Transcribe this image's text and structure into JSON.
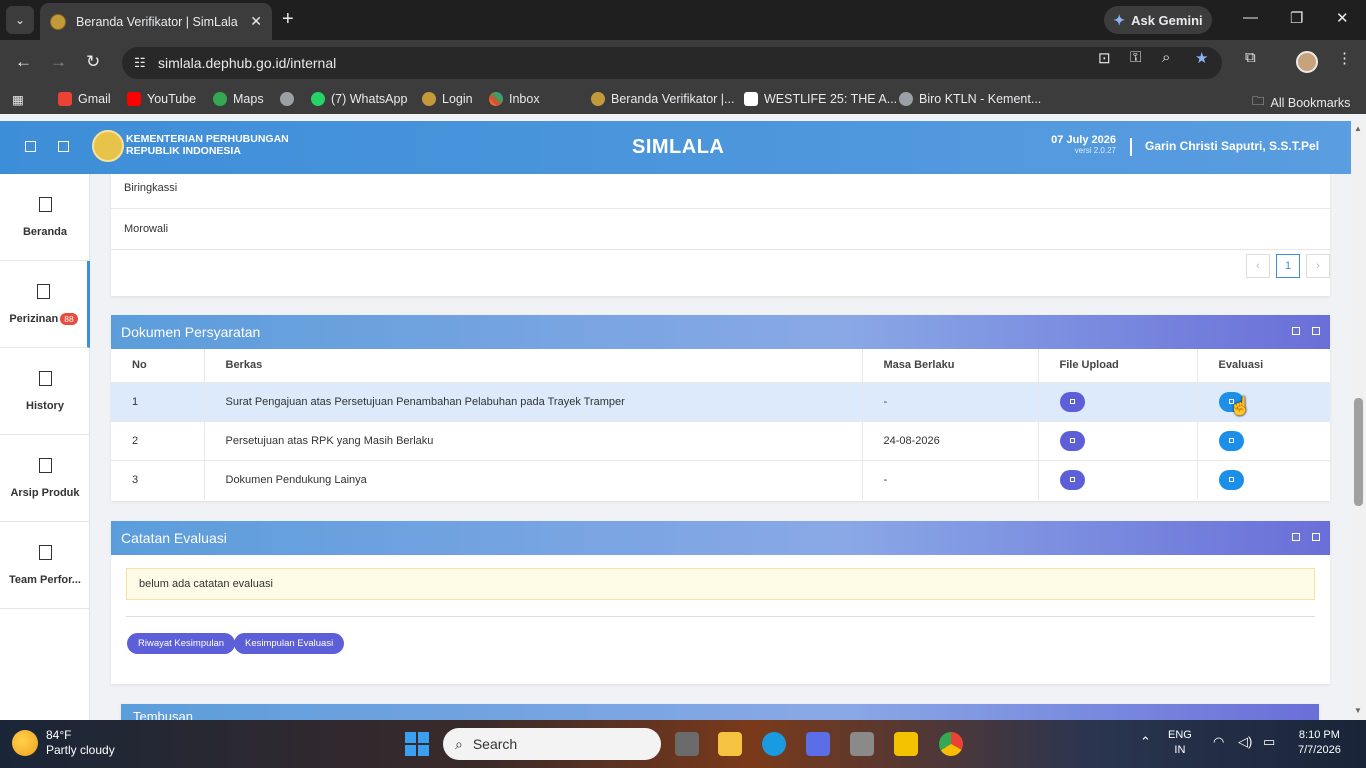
{
  "browser": {
    "tab_title": "Beranda Verifikator | SimLala",
    "url": "simlala.dephub.go.id/internal",
    "ask_gemini": "Ask Gemini",
    "bookmarks": [
      "Gmail",
      "YouTube",
      "Maps",
      "(7) WhatsApp",
      "Login",
      "Inbox",
      "Beranda Verifikator |...",
      "WESTLIFE 25: THE A...",
      "Biro KTLN - Kement..."
    ],
    "all_bookmarks": "All Bookmarks"
  },
  "header": {
    "ministry_line1": "KEMENTERIAN PERHUBUNGAN",
    "ministry_line2": "REPUBLIK INDONESIA",
    "app_name": "SIMLALA",
    "date": "07 July 2026",
    "version": "versi 2.0.27",
    "user": "Garin Christi Saputri, S.S.T.Pel"
  },
  "sidebar": {
    "items": [
      {
        "label": "Beranda"
      },
      {
        "label": "Perizinan",
        "badge": "88"
      },
      {
        "label": "History"
      },
      {
        "label": "Arsip Produk"
      },
      {
        "label": "Team Perfor..."
      }
    ]
  },
  "locations": {
    "rows": [
      "Biringkassi",
      "Morowali"
    ],
    "pager": {
      "prev": "‹",
      "page": "1",
      "next": "›"
    }
  },
  "dokumen": {
    "title": "Dokumen Persyaratan",
    "columns": [
      "No",
      "Berkas",
      "Masa Berlaku",
      "File Upload",
      "Evaluasi"
    ],
    "rows": [
      {
        "no": "1",
        "berkas": "Surat Pengajuan atas Persetujuan Penambahan Pelabuhan pada Trayek Tramper",
        "masa": "-"
      },
      {
        "no": "2",
        "berkas": "Persetujuan atas RPK yang Masih Berlaku",
        "masa": "24-08-2026"
      },
      {
        "no": "3",
        "berkas": "Dokumen Pendukung Lainya",
        "masa": "-"
      }
    ]
  },
  "catatan": {
    "title": "Catatan Evaluasi",
    "note": "belum ada catatan evaluasi",
    "btn_riwayat": "Riwayat Kesimpulan",
    "btn_kesimpulan": "Kesimpulan Evaluasi"
  },
  "tembusan": {
    "title": "Tembusan"
  },
  "taskbar": {
    "temp": "84°F",
    "weather": "Partly cloudy",
    "search": "Search",
    "lang1": "ENG",
    "lang2": "IN",
    "time": "8:10 PM",
    "date": "7/7/2026"
  }
}
